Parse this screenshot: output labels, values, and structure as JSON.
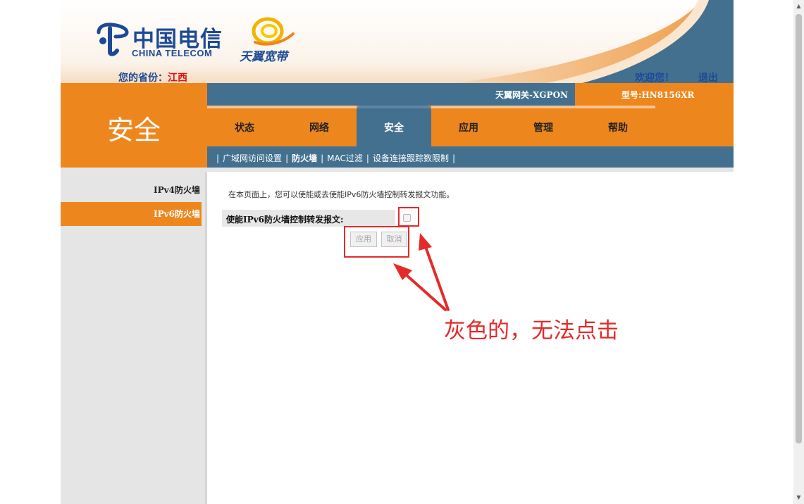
{
  "header": {
    "logo_cn": "中国电信",
    "logo_en": "CHINA TELECOM",
    "brand": "天翼宽带",
    "province_label": "您的省份：",
    "province_value": "江西",
    "welcome": "欢迎您！",
    "logout": "退出"
  },
  "section": {
    "title": "安全"
  },
  "infobar": {
    "gateway": "天翼网关-XGPON",
    "model": "型号:HN8156XR"
  },
  "tabs": [
    {
      "label": "状态",
      "active": false
    },
    {
      "label": "网络",
      "active": false
    },
    {
      "label": "安全",
      "active": true
    },
    {
      "label": "应用",
      "active": false
    },
    {
      "label": "管理",
      "active": false
    },
    {
      "label": "帮助",
      "active": false
    }
  ],
  "subnav": {
    "separator": "|",
    "items": [
      {
        "label": "广域网访问设置",
        "active": false
      },
      {
        "label": "防火墙",
        "active": true
      },
      {
        "label": "MAC过滤",
        "active": false
      },
      {
        "label": "设备连接跟踪数限制",
        "active": false
      }
    ]
  },
  "sidebar": {
    "items": [
      {
        "label": "IPv4防火墙",
        "active": false
      },
      {
        "label": "IPv6防火墙",
        "active": true
      }
    ]
  },
  "content": {
    "description": "在本页面上，您可以使能或去使能IPv6防火墙控制转发报文功能。",
    "setting_label": "使能IPv6防火墙控制转发报文:",
    "checkbox_checked": false,
    "apply_button": "应用",
    "cancel_button": "取消"
  },
  "annotation": {
    "text": "灰色的，无法点击",
    "color": "#e52a2a"
  },
  "colors": {
    "orange": "#ee861e",
    "steel_blue": "#43708f",
    "brand_blue": "#1d4a96"
  }
}
